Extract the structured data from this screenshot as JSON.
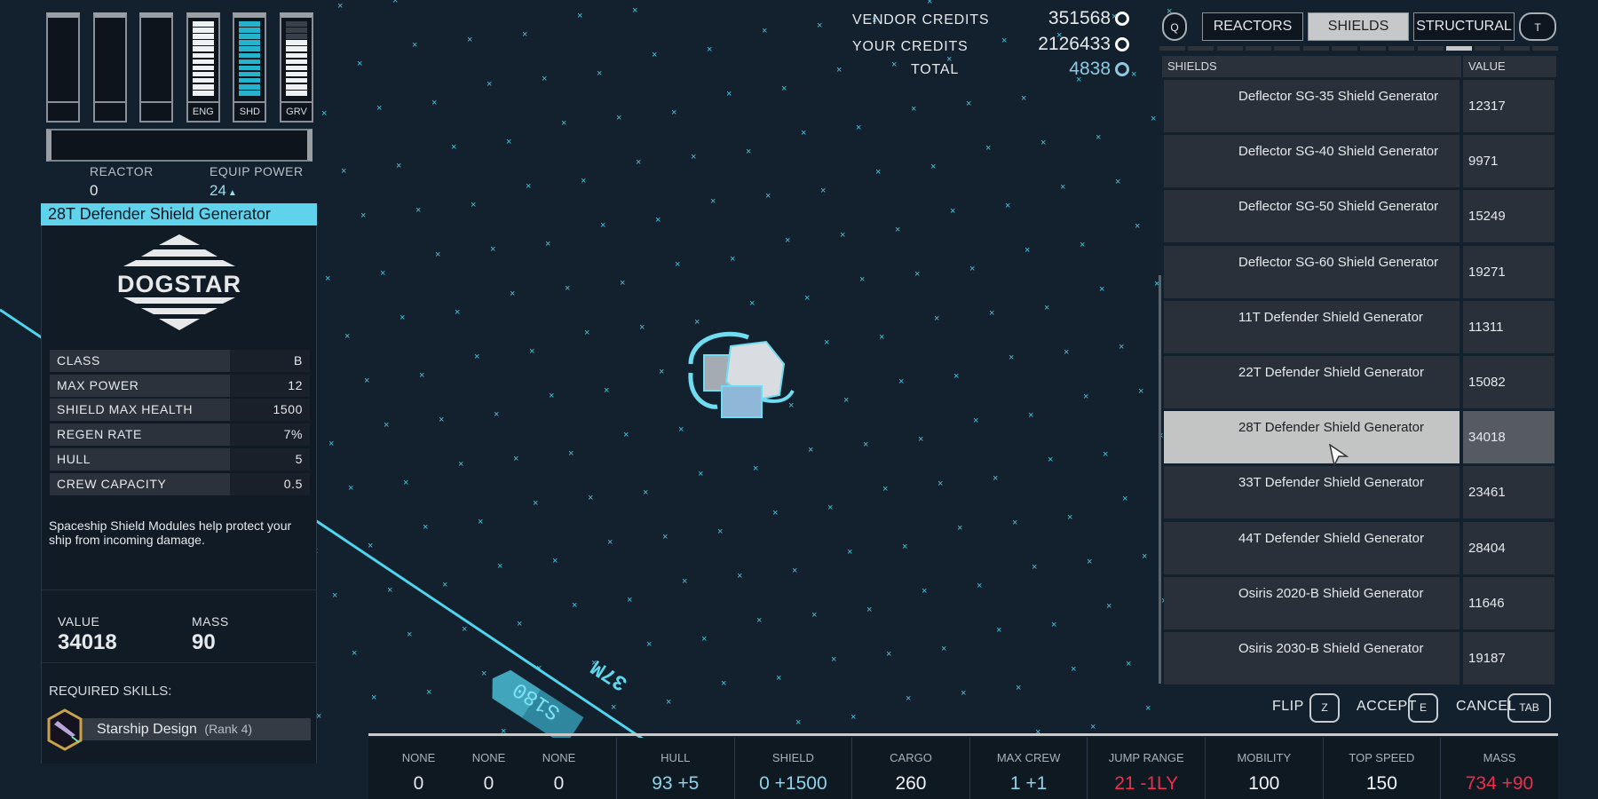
{
  "power": {
    "columns": [
      {
        "label": "",
        "filled": 0,
        "total": 12
      },
      {
        "label": "",
        "filled": 0,
        "total": 12
      },
      {
        "label": "",
        "filled": 0,
        "total": 12
      },
      {
        "label": "ENG",
        "filled": 12,
        "total": 12,
        "color": "#eef1f4"
      },
      {
        "label": "SHD",
        "filled": 12,
        "total": 12,
        "color": "#23b3cc"
      },
      {
        "label": "GRV",
        "filled": 9,
        "total": 12,
        "color": "#eef1f4"
      }
    ],
    "reactor_label": "REACTOR",
    "reactor_value": "0",
    "equip_label": "EQUIP POWER",
    "equip_value": "24"
  },
  "item": {
    "title": "28T Defender Shield Generator",
    "logo": "DOGSTAR",
    "stats": [
      {
        "label": "CLASS",
        "value": "B"
      },
      {
        "label": "MAX POWER",
        "value": "12"
      },
      {
        "label": "SHIELD MAX HEALTH",
        "value": "1500"
      },
      {
        "label": "REGEN RATE",
        "value": "7%"
      },
      {
        "label": "HULL",
        "value": "5"
      },
      {
        "label": "CREW CAPACITY",
        "value": "0.5"
      }
    ],
    "description": "Spaceship Shield Modules help protect your ship from incoming damage.",
    "value_label": "VALUE",
    "value": "34018",
    "mass_label": "MASS",
    "mass": "90",
    "skills_label": "REQUIRED SKILLS:",
    "skill": "Starship Design",
    "skill_rank": "(Rank 4)"
  },
  "credits": {
    "vendor_label": "VENDOR CREDITS",
    "vendor": "351568",
    "your_label": "YOUR CREDITS",
    "your": "2126433",
    "total_label": "TOTAL",
    "total": "4838"
  },
  "tabs": {
    "prev_key": "Q",
    "next_key": "T",
    "items": [
      "REACTORS",
      "SHIELDS",
      "STRUCTURAL"
    ],
    "selected": "SHIELDS",
    "pages": 14,
    "current_page": 11
  },
  "list": {
    "col_name": "SHIELDS",
    "col_value": "VALUE",
    "selected": "28T Defender Shield Generator",
    "items": [
      {
        "name": "Deflector SG-35 Shield Generator",
        "value": "12317",
        "icon": "deflector-icon"
      },
      {
        "name": "Deflector SG-40 Shield Generator",
        "value": "9971",
        "icon": "deflector-icon"
      },
      {
        "name": "Deflector SG-50 Shield Generator",
        "value": "15249",
        "icon": "deflector-icon"
      },
      {
        "name": "Deflector SG-60 Shield Generator",
        "value": "19271",
        "icon": "deflector-icon"
      },
      {
        "name": "11T Defender Shield Generator",
        "value": "11311",
        "icon": "defender-icon"
      },
      {
        "name": "22T Defender Shield Generator",
        "value": "15082",
        "icon": "defender-icon"
      },
      {
        "name": "28T Defender Shield Generator",
        "value": "34018",
        "icon": "defender-icon"
      },
      {
        "name": "33T Defender Shield Generator",
        "value": "23461",
        "icon": "defender-icon"
      },
      {
        "name": "44T Defender Shield Generator",
        "value": "28404",
        "icon": "defender-icon"
      },
      {
        "name": "Osiris 2020-B Shield Generator",
        "value": "11646",
        "icon": "osiris-icon"
      },
      {
        "name": "Osiris 2030-B Shield Generator",
        "value": "19187",
        "icon": "osiris-icon"
      }
    ]
  },
  "actions": [
    {
      "label": "FLIP",
      "key": "Z"
    },
    {
      "label": "ACCEPT",
      "key": "E"
    },
    {
      "label": "CANCEL",
      "key": "TAB"
    }
  ],
  "viewport": {
    "distance": "37M",
    "heading": "S180"
  },
  "bottom": {
    "slots": [
      {
        "label": "NONE",
        "value": "0"
      },
      {
        "label": "NONE",
        "value": "0"
      },
      {
        "label": "NONE",
        "value": "0"
      }
    ],
    "stats": [
      {
        "label": "HULL",
        "value": "93 +5",
        "color": "#8fd3ea"
      },
      {
        "label": "SHIELD",
        "value": "0 +1500",
        "color": "#8fd3ea"
      },
      {
        "label": "CARGO",
        "value": "260",
        "color": "#f1f3f5"
      },
      {
        "label": "MAX CREW",
        "value": "1 +1",
        "color": "#8fd3ea"
      },
      {
        "label": "JUMP RANGE",
        "value": "21 -1LY",
        "color": "#ee2e4a"
      },
      {
        "label": "MOBILITY",
        "value": "100",
        "color": "#f1f3f5"
      },
      {
        "label": "TOP SPEED",
        "value": "150",
        "color": "#f1f3f5"
      },
      {
        "label": "MASS",
        "value": "734 +90",
        "color": "#ee2e4a"
      }
    ]
  },
  "colors": {
    "accent": "#5fd3ec",
    "background": "#13212e",
    "negative": "#ee2e4a",
    "positive": "#8fd3ea"
  }
}
